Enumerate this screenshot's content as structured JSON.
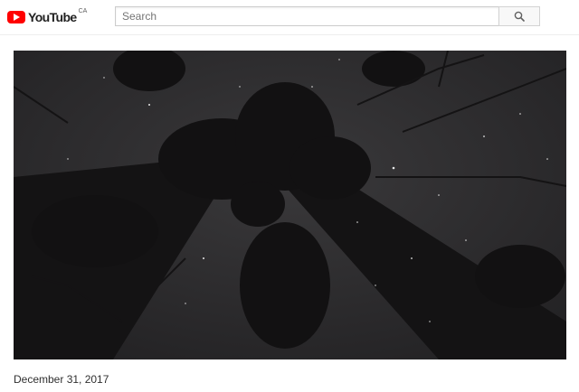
{
  "header": {
    "logo_text": "YouTube",
    "country_code": "CA",
    "logo_icon": "youtube-play-icon",
    "brand_color": "#ff0000"
  },
  "search": {
    "placeholder": "Search",
    "value": "",
    "button_icon": "search-icon"
  },
  "video": {
    "description": "night sky with stars seen through tall tree silhouettes"
  },
  "meta": {
    "date": "December 31, 2017"
  }
}
